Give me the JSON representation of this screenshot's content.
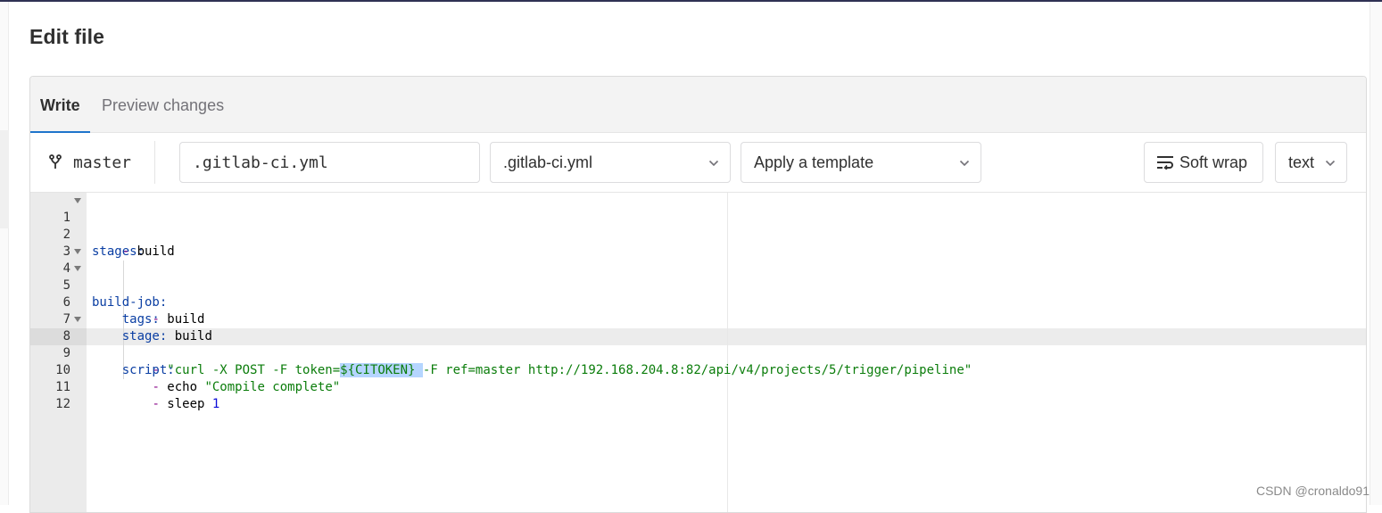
{
  "page": {
    "title": "Edit file"
  },
  "tabs": [
    {
      "label": "Write",
      "active": true
    },
    {
      "label": "Preview changes",
      "active": false
    }
  ],
  "toolbar": {
    "branch": "master",
    "branch_icon": "branch-icon",
    "file_name_value": ".gitlab-ci.yml",
    "file_type_select": ".gitlab-ci.yml",
    "template_select": "Apply a template",
    "soft_wrap_label": "Soft wrap",
    "soft_wrap_icon": "soft-wrap-icon",
    "mode_select": "text"
  },
  "editor": {
    "active_line": 9,
    "lines": [
      {
        "num": "1"
      },
      {
        "num": "2"
      },
      {
        "num": "3"
      },
      {
        "num": "4"
      },
      {
        "num": "5"
      },
      {
        "num": "6"
      },
      {
        "num": "7"
      },
      {
        "num": "8"
      },
      {
        "num": "9"
      },
      {
        "num": "10"
      },
      {
        "num": "11"
      },
      {
        "num": "12"
      }
    ],
    "tokens": {
      "l1_key": "stages:",
      "l2_dash": "- ",
      "l2_val": "build",
      "l4_key": "build-job:",
      "l5_key": "tags:",
      "l6_dash": "- ",
      "l6_val": "build",
      "l7_key": "stage:",
      "l7_val": " build",
      "l8_key": "script:",
      "l9_dash": "- ",
      "l9_str_a": "\"curl -X POST -F token=",
      "l9_sel": "${CITOKEN} ",
      "l9_str_b": "-F ref=master http://192.168.204.8:82/api/v4/projects/5/trigger/pipeline\"",
      "l10_dash": "- ",
      "l10_cmd": "echo ",
      "l10_str": "\"Compile complete\"",
      "l11_dash": "- ",
      "l11_cmd": "sleep ",
      "l11_num": "1"
    }
  },
  "watermark": "CSDN @cronaldo91",
  "colors": {
    "accent": "#1f75cb",
    "key": "#0a3ea3",
    "string": "#0b7d0b",
    "number": "#0b0bd8",
    "selection": "#b5d5ff"
  }
}
